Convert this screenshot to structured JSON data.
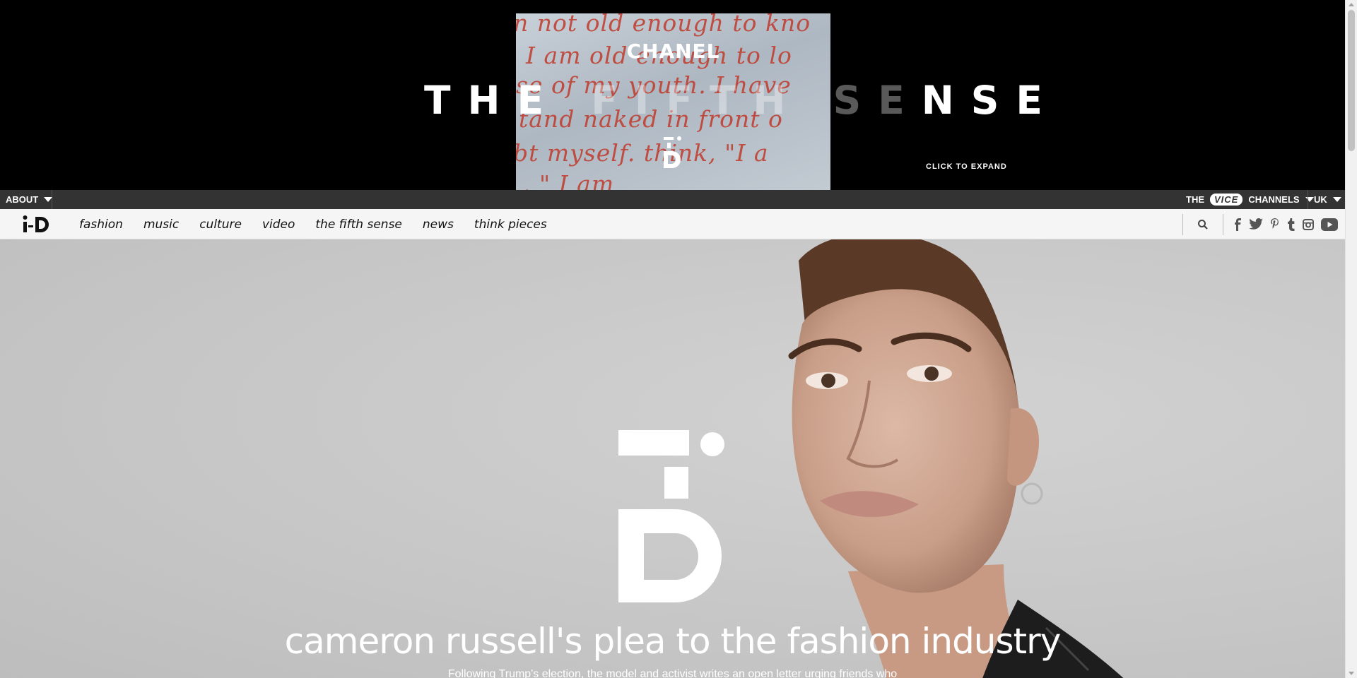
{
  "ad": {
    "brand": "CHANEL",
    "headline_start": "THE ",
    "headline_ghost": "FIFTH SE",
    "headline_end": "NSE",
    "expand_label": "CLICK TO EXPAND",
    "handwriting_lines": [
      "n not old enough to kno",
      "I am old enough to lo",
      "se of my youth. I have",
      "tand naked in front o",
      "bt myself. think, \"I a",
      "  .             \" I am"
    ]
  },
  "top_bar": {
    "about_label": "ABOUT",
    "channels_prefix": "THE",
    "vice_logo": "VICE",
    "channels_label": "CHANNELS",
    "region_label": "UK"
  },
  "nav": {
    "logo_text": "i-D",
    "links": [
      "fashion",
      "music",
      "culture",
      "video",
      "the fifth sense",
      "news",
      "think pieces"
    ],
    "search_icon": "search-icon",
    "social_icons": [
      "facebook-icon",
      "twitter-icon",
      "pinterest-icon",
      "tumblr-icon",
      "instagram-icon",
      "youtube-icon"
    ]
  },
  "hero": {
    "title": "cameron russell's plea to the fashion industry",
    "subtitle": "Following Trump's election, the model and activist writes an open letter urging friends who"
  },
  "colors": {
    "ad_background": "#000000",
    "top_bar": "#333333",
    "nav_background": "#f5f5f5",
    "hero_background": "#c8c8c8",
    "handwriting_red": "#c0392b"
  }
}
